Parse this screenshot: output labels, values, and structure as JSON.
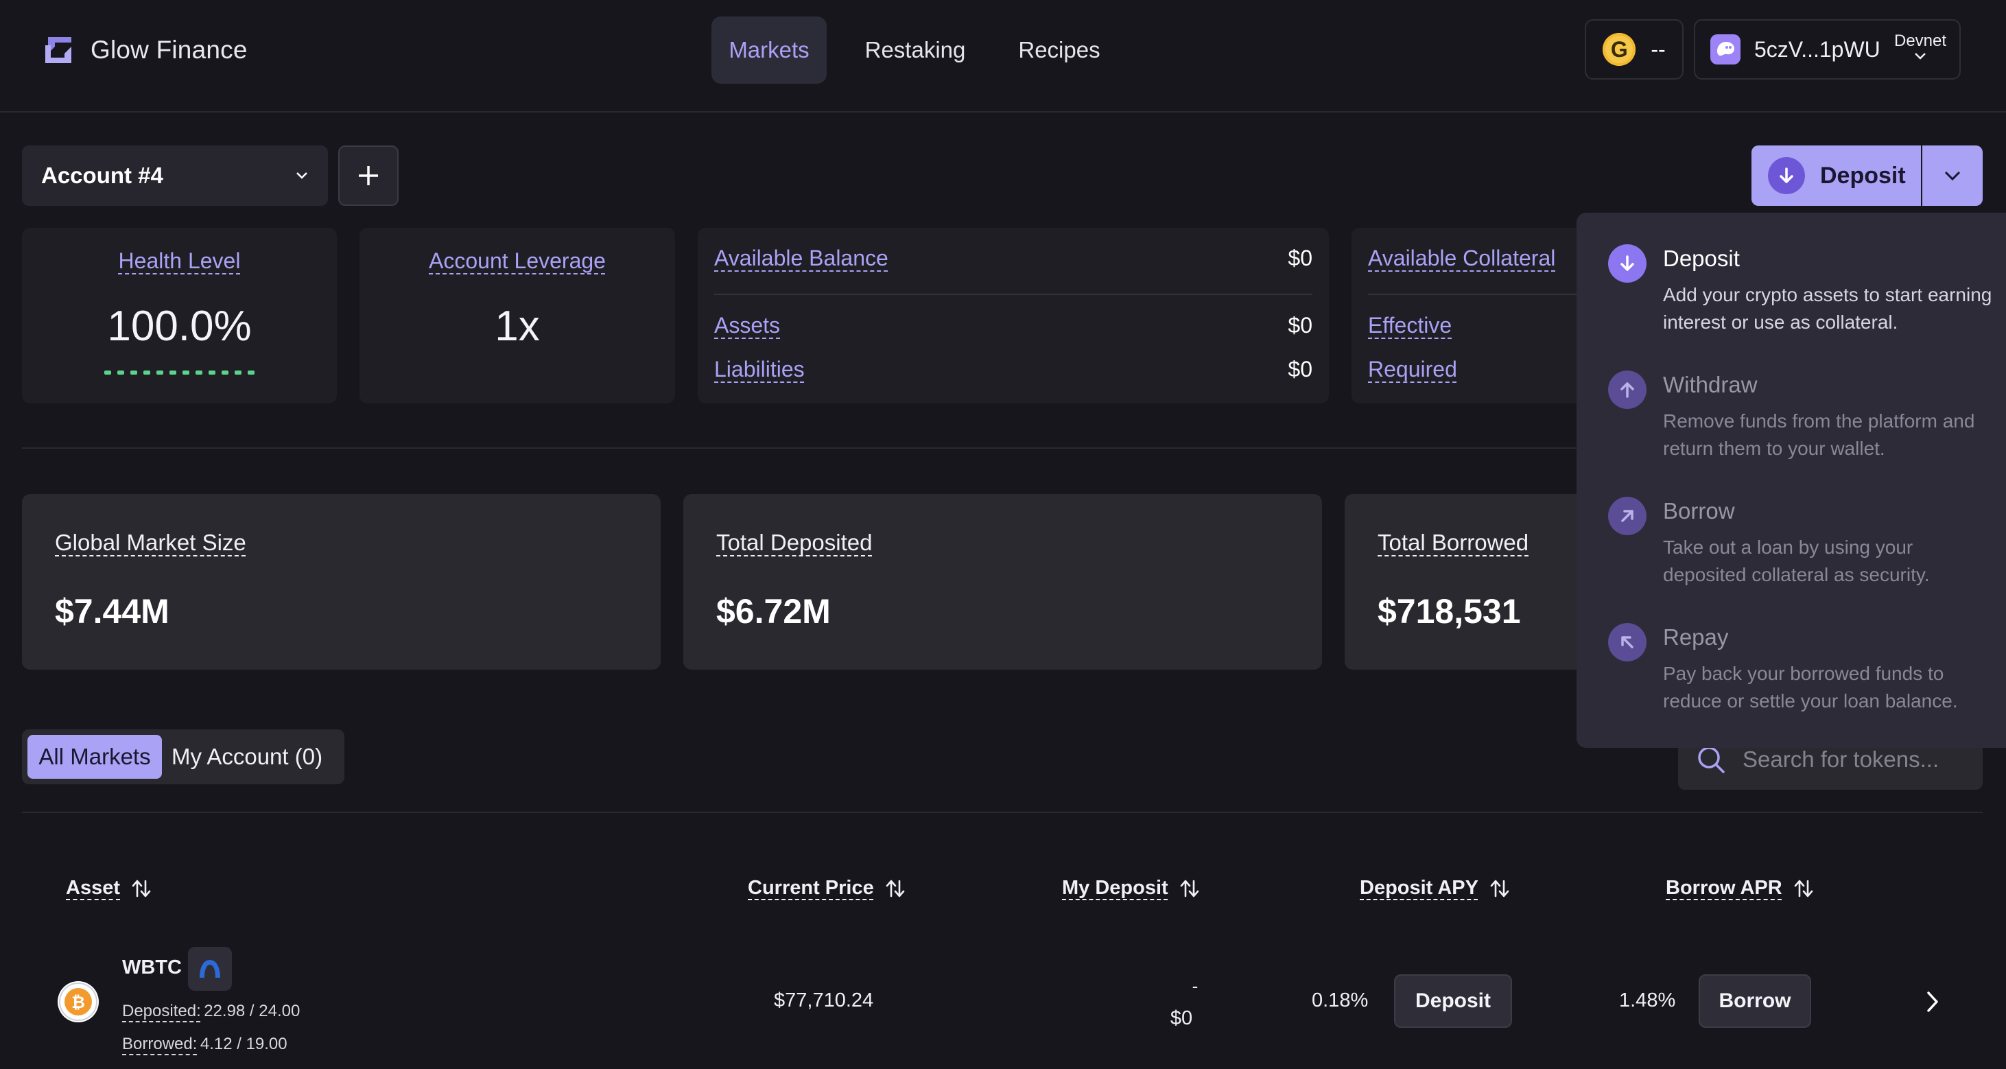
{
  "app": {
    "name": "Glow Finance",
    "nav": [
      "Markets",
      "Restaking",
      "Recipes"
    ],
    "token_balance": "--",
    "wallet_address": "5czV...1pWU",
    "network": "Devnet"
  },
  "account": {
    "selected": "Account #4"
  },
  "deposit_button": {
    "label": "Deposit"
  },
  "stats": {
    "health_label": "Health Level",
    "health_value": "100.0%",
    "health_fill": 1.0,
    "leverage_label": "Account Leverage",
    "leverage_value": "1x",
    "available_balance_label": "Available Balance",
    "available_balance_value": "$0",
    "assets_label": "Assets",
    "assets_value": "$0",
    "liabilities_label": "Liabilities",
    "liabilities_value": "$0",
    "available_collateral_label": "Available Collateral",
    "effective_label": "Effective",
    "required_label": "Required"
  },
  "market": {
    "global_size_label": "Global Market Size",
    "global_size_value": "$7.44M",
    "total_deposited_label": "Total Deposited",
    "total_deposited_value": "$6.72M",
    "total_borrowed_label": "Total Borrowed",
    "total_borrowed_value": "$718,531"
  },
  "tabs": {
    "all": "All Markets",
    "mine": "My Account (0)"
  },
  "search": {
    "placeholder": "Search for tokens..."
  },
  "table": {
    "headers": {
      "asset": "Asset",
      "price": "Current Price",
      "my_deposit": "My Deposit",
      "deposit_apy": "Deposit APY",
      "borrow_apr": "Borrow APR"
    },
    "rows": [
      {
        "symbol": "WBTC",
        "deposited_label": "Deposited:",
        "deposited_value": "22.98 / 24.00",
        "borrowed_label": "Borrowed:",
        "borrowed_value": "4.12 / 19.00",
        "price": "$77,710.24",
        "my_deposit_amount": "-",
        "my_deposit_usd": "$0",
        "deposit_apy": "0.18%",
        "deposit_btn": "Deposit",
        "borrow_apr": "1.48%",
        "borrow_btn": "Borrow"
      }
    ]
  },
  "dropdown": {
    "items": [
      {
        "title": "Deposit",
        "desc": "Add your crypto assets to start earning interest or use as collateral.",
        "icon": "arrow-down-icon"
      },
      {
        "title": "Withdraw",
        "desc": "Remove funds from the platform and return them to your wallet.",
        "icon": "arrow-up-icon"
      },
      {
        "title": "Borrow",
        "desc": "Take out a loan by using your deposited collateral as security.",
        "icon": "arrow-up-right-icon"
      },
      {
        "title": "Repay",
        "desc": "Pay back your borrowed funds to reduce or settle your loan balance.",
        "icon": "arrow-up-left-icon"
      }
    ]
  },
  "colors": {
    "background": "#17161c",
    "accent": "#a9a2f5",
    "accent_dark": "#6d57d6",
    "card": "#1f1e25",
    "card_alt": "#2a2930",
    "health_green": "#5bd38b"
  }
}
